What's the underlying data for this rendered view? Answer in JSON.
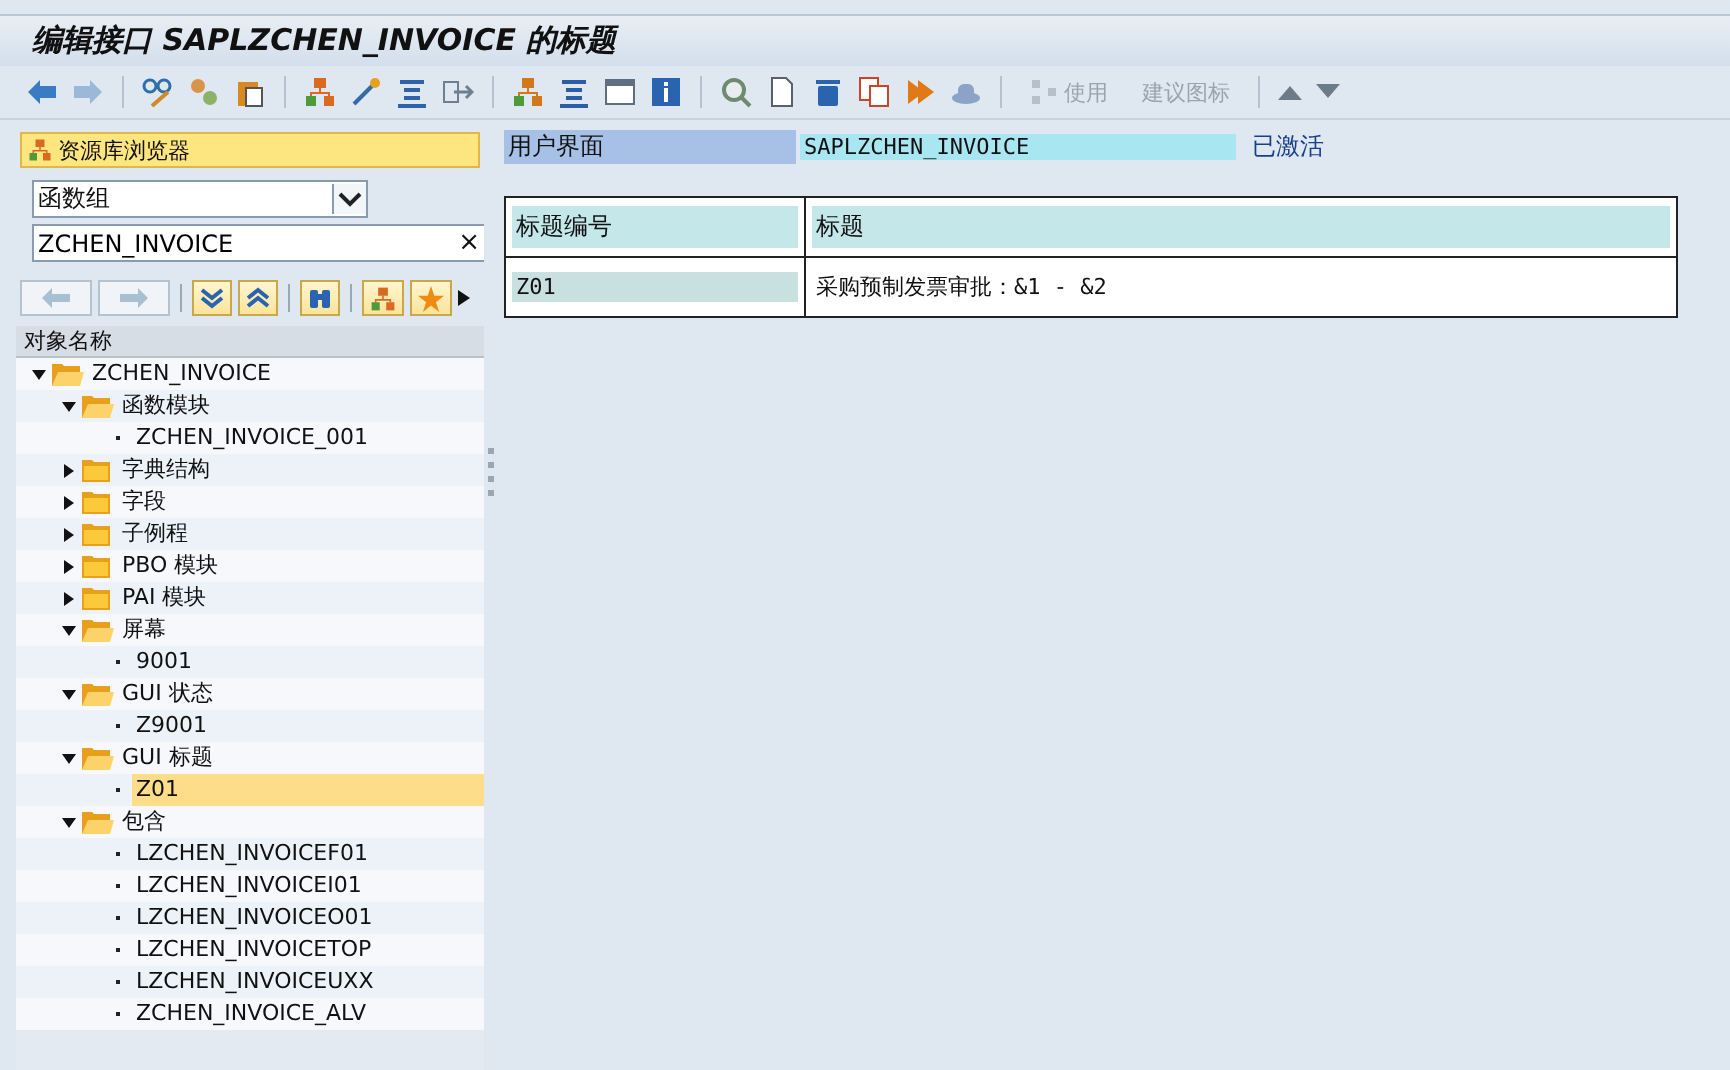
{
  "window": {
    "title": "编辑接口 SAPLZCHEN_INVOICE 的标题"
  },
  "toolbar": {
    "text_buttons": [
      {
        "label": "使用",
        "disabled": true,
        "kind": "icon_text"
      },
      {
        "label": "建议图标",
        "disabled": true,
        "kind": "text"
      }
    ]
  },
  "sidebar": {
    "title": "资源库浏览器",
    "object_type": "函数组",
    "object_name": "ZCHEN_INVOICE",
    "clear": "×",
    "column": "对象名称",
    "tree": [
      {
        "label": "ZCHEN_INVOICE",
        "kind": "folder",
        "expanded": true,
        "selected": false,
        "children": [
          {
            "label": "函数模块",
            "kind": "folder",
            "expanded": true,
            "selected": false,
            "children": [
              {
                "label": "ZCHEN_INVOICE_001",
                "kind": "leaf",
                "selected": false
              }
            ]
          },
          {
            "label": "字典结构",
            "kind": "folder",
            "expanded": false,
            "selected": false
          },
          {
            "label": "字段",
            "kind": "folder",
            "expanded": false,
            "selected": false
          },
          {
            "label": "子例程",
            "kind": "folder",
            "expanded": false,
            "selected": false
          },
          {
            "label": "PBO 模块",
            "kind": "folder",
            "expanded": false,
            "selected": false
          },
          {
            "label": "PAI 模块",
            "kind": "folder",
            "expanded": false,
            "selected": false
          },
          {
            "label": "屏幕",
            "kind": "folder",
            "expanded": true,
            "selected": false,
            "children": [
              {
                "label": "9001",
                "kind": "leaf",
                "selected": false
              }
            ]
          },
          {
            "label": "GUI 状态",
            "kind": "folder",
            "expanded": true,
            "selected": false,
            "children": [
              {
                "label": "Z9001",
                "kind": "leaf",
                "selected": false
              }
            ]
          },
          {
            "label": "GUI 标题",
            "kind": "folder",
            "expanded": true,
            "selected": false,
            "children": [
              {
                "label": "Z01",
                "kind": "leaf",
                "selected": true
              }
            ]
          },
          {
            "label": "包含",
            "kind": "folder",
            "expanded": true,
            "selected": false,
            "children": [
              {
                "label": "LZCHEN_INVOICEF01",
                "kind": "leaf",
                "selected": false
              },
              {
                "label": "LZCHEN_INVOICEI01",
                "kind": "leaf",
                "selected": false
              },
              {
                "label": "LZCHEN_INVOICEO01",
                "kind": "leaf",
                "selected": false
              },
              {
                "label": "LZCHEN_INVOICETOP",
                "kind": "leaf",
                "selected": false
              },
              {
                "label": "LZCHEN_INVOICEUXX",
                "kind": "leaf",
                "selected": false
              },
              {
                "label": "ZCHEN_INVOICE_ALV",
                "kind": "leaf",
                "selected": false
              }
            ]
          }
        ]
      }
    ]
  },
  "header": {
    "label": "用户界面",
    "value": "SAPLZCHEN_INVOICE",
    "status": "已激活"
  },
  "table": {
    "columns": [
      "标题编号",
      "标题"
    ],
    "rows": [
      [
        "Z01",
        "采购预制发票审批：&1 - &2"
      ]
    ]
  }
}
